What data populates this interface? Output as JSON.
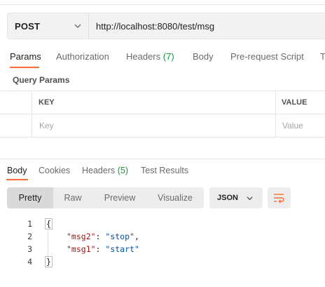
{
  "request": {
    "method": "POST",
    "url": "http://localhost:8080/test/msg"
  },
  "request_tabs": [
    {
      "label": "Params"
    },
    {
      "label": "Authorization"
    },
    {
      "label": "Headers",
      "count": "(7)"
    },
    {
      "label": "Body"
    },
    {
      "label": "Pre-request Script"
    },
    {
      "label": "T"
    }
  ],
  "query_params": {
    "title": "Query Params",
    "key_header": "KEY",
    "value_header": "VALUE",
    "key_placeholder": "Key",
    "value_placeholder": "Value"
  },
  "response_tabs": [
    {
      "label": "Body"
    },
    {
      "label": "Cookies"
    },
    {
      "label": "Headers",
      "count": "(5)"
    },
    {
      "label": "Test Results"
    }
  ],
  "view_modes": [
    "Pretty",
    "Raw",
    "Preview",
    "Visualize"
  ],
  "format": "JSON",
  "code": {
    "line_numbers": [
      "1",
      "2",
      "3",
      "4"
    ],
    "open_brace": "{",
    "close_brace": "}",
    "entries": [
      {
        "key": "\"msg2\"",
        "sep": ": ",
        "value": "\"stop\"",
        "trail": ","
      },
      {
        "key": "\"msg1\"",
        "sep": ": ",
        "value": "\"start\"",
        "trail": ""
      }
    ]
  },
  "colors": {
    "accent": "#ff6c37",
    "count_green": "#0c9b3b",
    "json_key": "#a31515",
    "json_string": "#0451a5"
  },
  "icons": [
    "chevron-down-icon",
    "wrap-lines-icon"
  ]
}
